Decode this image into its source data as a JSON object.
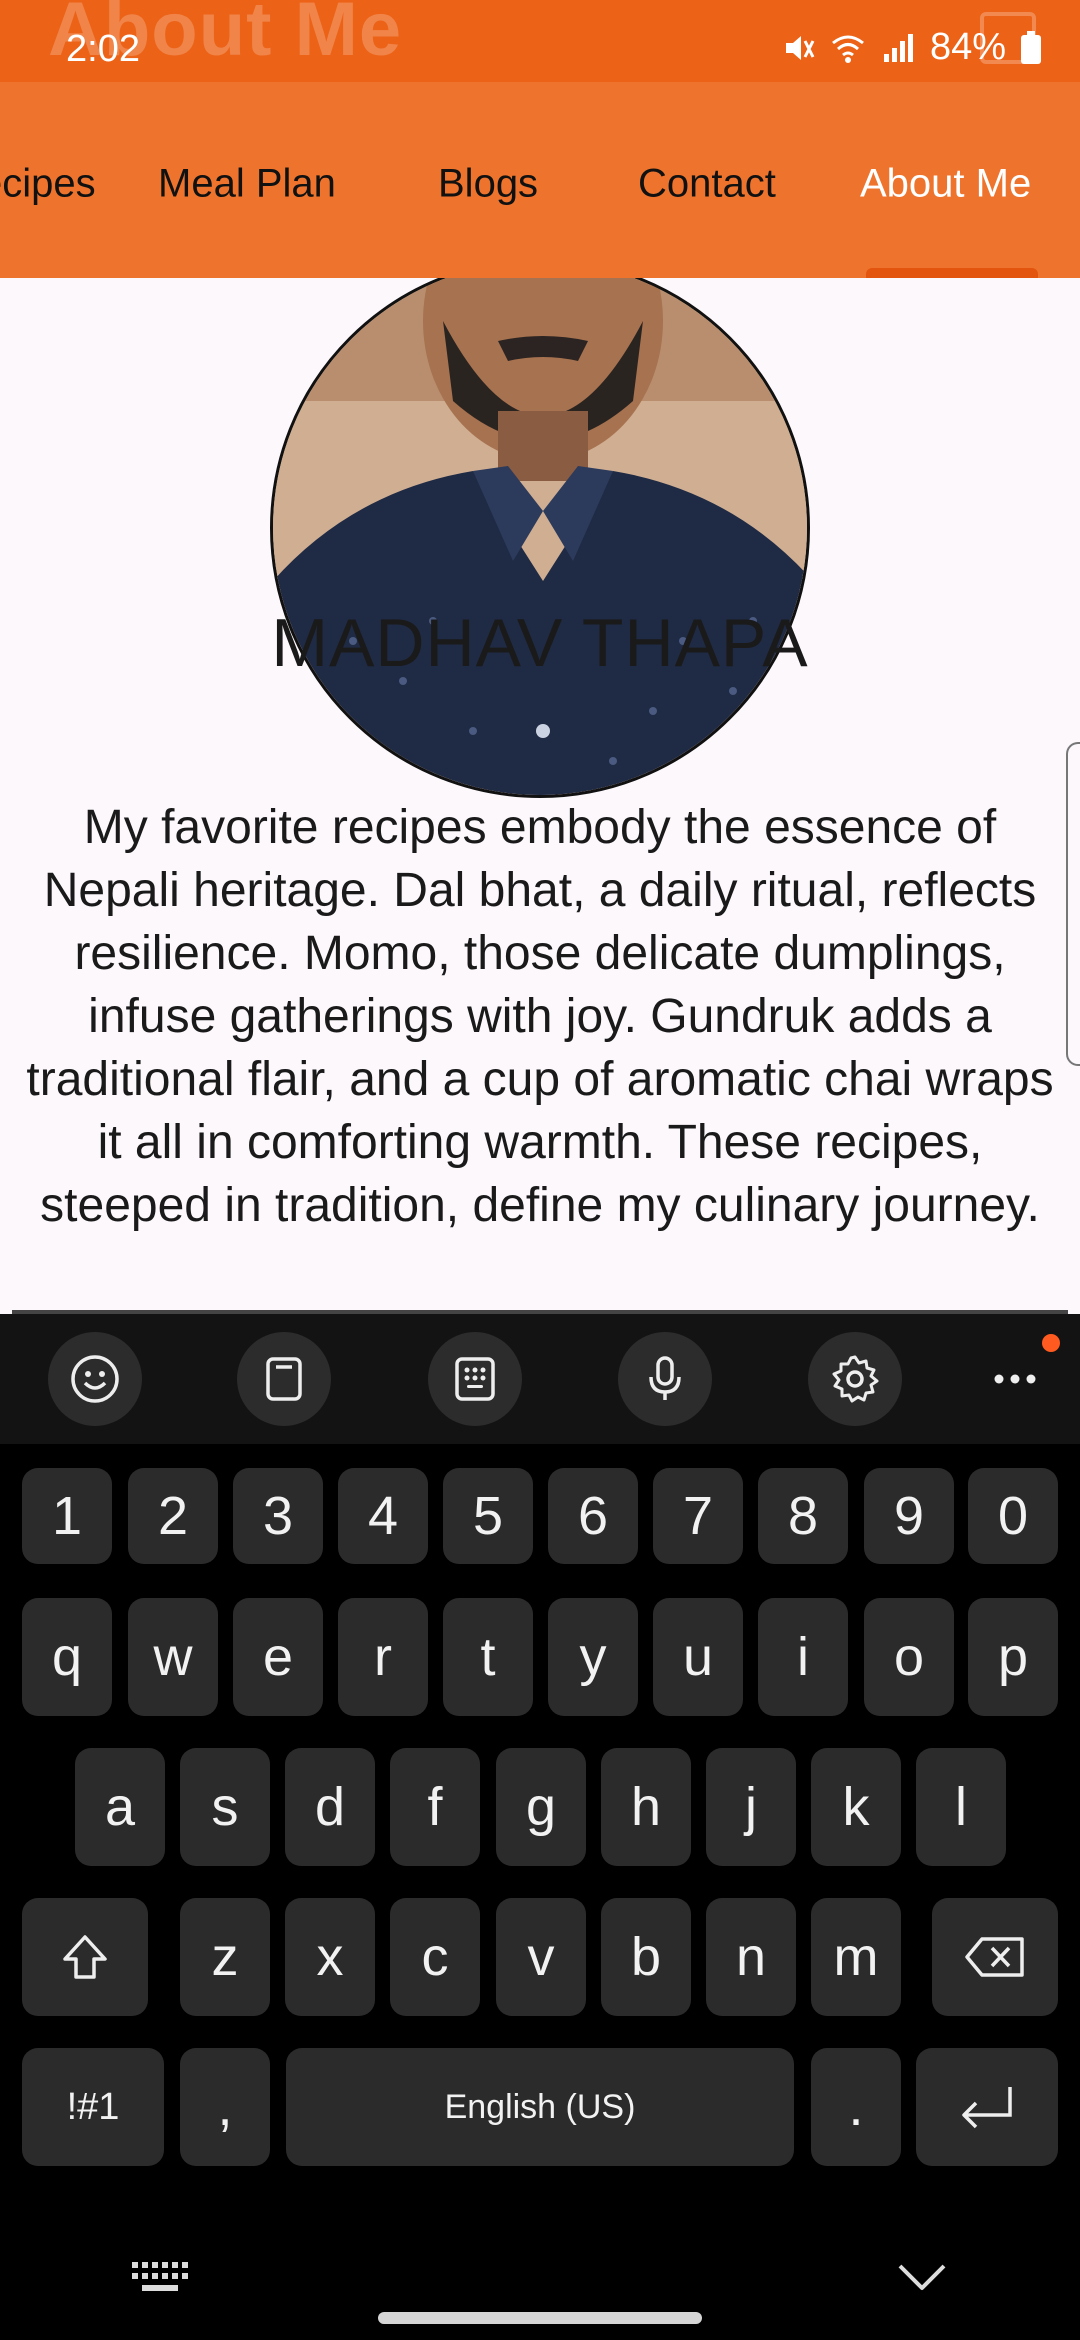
{
  "status": {
    "time": "2:02",
    "battery": "84%",
    "ghost_title": "About Me"
  },
  "nav": {
    "items": [
      {
        "label": "ecipes"
      },
      {
        "label": "Meal Plan"
      },
      {
        "label": "Blogs"
      },
      {
        "label": "Contact"
      },
      {
        "label": "About Me"
      }
    ],
    "active_index": 4
  },
  "profile": {
    "name": "MADHAV THAPA",
    "bio": "My favorite recipes embody the essence of Nepali heritage. Dal bhat, a daily ritual, reflects resilience. Momo, those delicate dumplings, infuse gatherings with joy. Gundruk adds a traditional flair, and a cup of aromatic chai wraps it all in comforting warmth. These recipes, steeped in tradition, define my culinary journey."
  },
  "keyboard": {
    "toolbar": [
      "emoji-icon",
      "clipboard-icon",
      "keypad-icon",
      "microphone-icon",
      "settings-icon",
      "more-icon"
    ],
    "row_numbers": [
      "1",
      "2",
      "3",
      "4",
      "5",
      "6",
      "7",
      "8",
      "9",
      "0"
    ],
    "row_1": [
      "q",
      "w",
      "e",
      "r",
      "t",
      "y",
      "u",
      "i",
      "o",
      "p"
    ],
    "row_2": [
      "a",
      "s",
      "d",
      "f",
      "g",
      "h",
      "j",
      "k",
      "l"
    ],
    "row_3": [
      "z",
      "x",
      "c",
      "v",
      "b",
      "n",
      "m"
    ],
    "symbols_label": "!#1",
    "comma_label": ",",
    "space_label": "English (US)",
    "period_label": "."
  },
  "colors": {
    "status_bar": "#ec6217",
    "nav_bar": "#ee742d",
    "active_nav": "#ffffff",
    "keyboard_bg": "#000000",
    "key_bg": "#2b2b2b"
  }
}
